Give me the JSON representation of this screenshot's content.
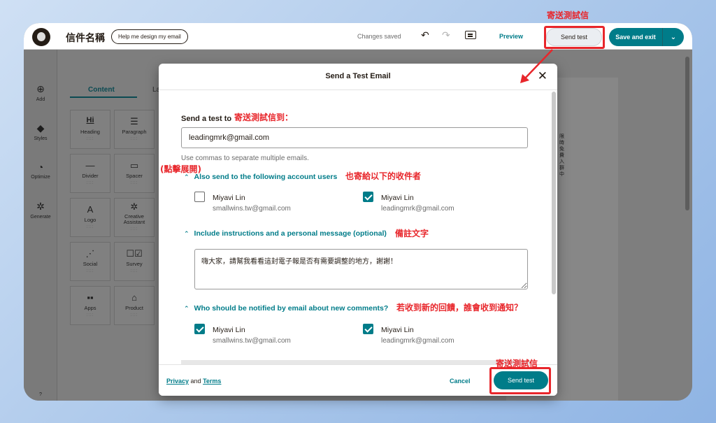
{
  "header": {
    "email_name": "信件名稱",
    "help_design_label": "Help me design my email",
    "changes_saved": "Changes saved",
    "preview_label": "Preview",
    "send_test_label": "Send test",
    "save_exit_label": "Save and exit"
  },
  "left_rail": {
    "items": [
      {
        "label": "Add",
        "icon": "plus-circle-icon"
      },
      {
        "label": "Styles",
        "icon": "paint-bucket-icon"
      },
      {
        "label": "Optimize",
        "icon": "gauge-icon"
      },
      {
        "label": "Generate",
        "icon": "sparkle-icon"
      },
      {
        "label": "?",
        "icon": "help-icon"
      }
    ]
  },
  "blocks_panel": {
    "tab_content": "Content",
    "tab_layouts": "La",
    "blocks": [
      {
        "label": "Heading",
        "glyph": "Hi"
      },
      {
        "label": "Paragraph",
        "glyph": "☰"
      },
      {
        "label": "Divider",
        "glyph": "—"
      },
      {
        "label": "Spacer",
        "glyph": "▭"
      },
      {
        "label": "Logo",
        "glyph": "A"
      },
      {
        "label": "Creative Assistant",
        "glyph": "✲"
      },
      {
        "label": "Social",
        "glyph": "⋰"
      },
      {
        "label": "Survey",
        "glyph": "☐☑"
      },
      {
        "label": "Apps",
        "glyph": "▪▪"
      },
      {
        "label": "Product",
        "glyph": "⌂"
      }
    ],
    "dots": "::::"
  },
  "canvas": {
    "side_text": "限時免費入群中"
  },
  "modal": {
    "title": "Send a Test Email",
    "send_to_label": "Send a test to",
    "email_value": "leadingmrk@gmail.com",
    "helper_text": "Use commas to separate multiple emails.",
    "also_send_label": "Also send to the following account users",
    "account_users": [
      {
        "name": "Miyavi Lin",
        "email": "smallwins.tw@gmail.com",
        "checked": false
      },
      {
        "name": "Miyavi Lin",
        "email": "leadingmrk@gmail.com",
        "checked": true
      }
    ],
    "instructions_label": "Include instructions and a personal message (optional)",
    "message_value": "嗨大家，請幫我看看這封電子報是否有需要調整的地方，謝謝！",
    "notify_label": "Who should be notified by email about new comments?",
    "notify_users": [
      {
        "name": "Miyavi Lin",
        "email": "smallwins.tw@gmail.com",
        "checked": true
      },
      {
        "name": "Miyavi Lin",
        "email": "leadingmrk@gmail.com",
        "checked": true
      }
    ],
    "footer": {
      "privacy": "Privacy",
      "and": "and",
      "terms": "Terms",
      "cancel": "Cancel",
      "send_test": "Send test"
    }
  },
  "annotations": {
    "top_send_test": "寄送測試信",
    "send_to": "寄送測試信到：",
    "click_expand": "(點擊展開)",
    "also_send": "也寄給以下的收件者",
    "note_text": "備註文字",
    "notify": "若收到新的回饋，誰會收到通知？",
    "bottom_send_test": "寄送測試信"
  },
  "colors": {
    "accent": "#007c89",
    "annotation": "#e8262b"
  }
}
